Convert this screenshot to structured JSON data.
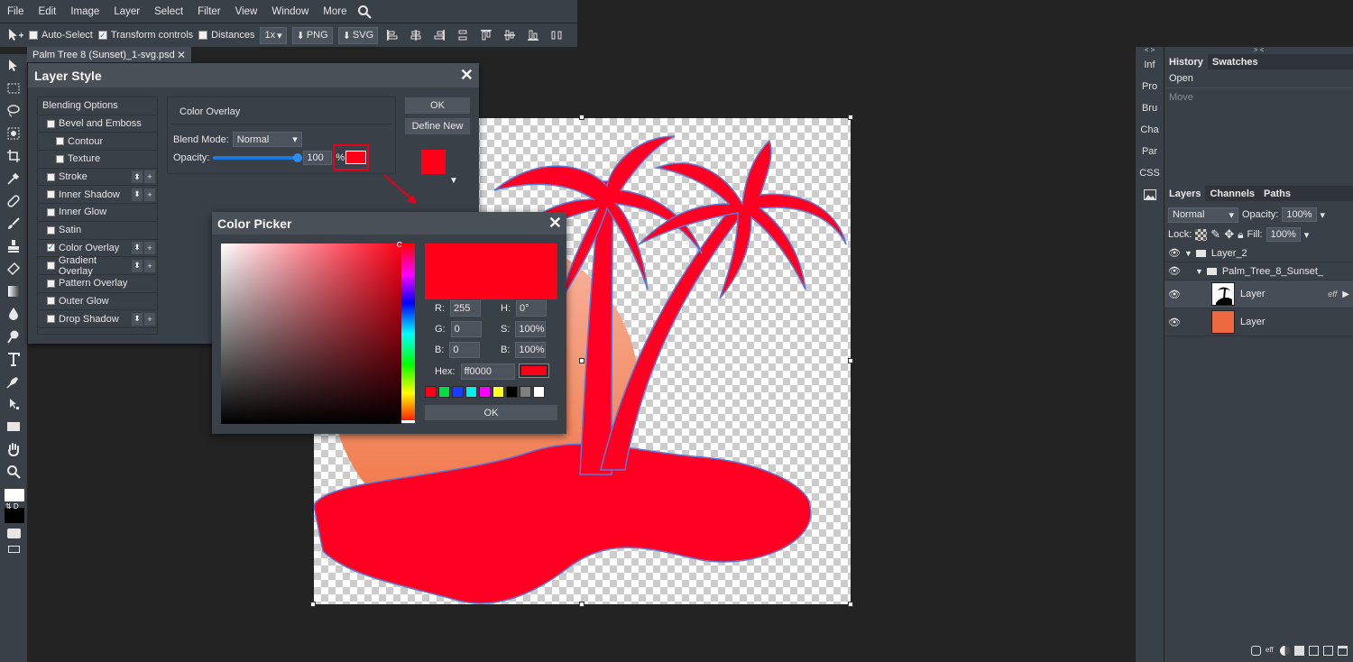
{
  "menu": {
    "items": [
      "File",
      "Edit",
      "Image",
      "Layer",
      "Select",
      "Filter",
      "View",
      "Window",
      "More"
    ]
  },
  "options_bar": {
    "auto_select": {
      "label": "Auto-Select",
      "checked": false
    },
    "transform_controls": {
      "label": "Transform controls",
      "checked": true
    },
    "distances": {
      "label": "Distances",
      "checked": false
    },
    "zoom": "1x",
    "png_label": "PNG",
    "svg_label": "SVG"
  },
  "document_tab": {
    "title": "Palm Tree 8 (Sunset)_1-svg.psd",
    "close": "✕"
  },
  "layer_style": {
    "title": "Layer Style",
    "close": "✕",
    "list": [
      {
        "label": "Blending Options",
        "type": "header"
      },
      {
        "label": "Bevel and Emboss",
        "checked": false,
        "sub": false,
        "controls": false
      },
      {
        "label": "Contour",
        "checked": false,
        "sub": true,
        "controls": false
      },
      {
        "label": "Texture",
        "checked": false,
        "sub": true,
        "controls": false
      },
      {
        "label": "Stroke",
        "checked": false,
        "sub": false,
        "controls": true
      },
      {
        "label": "Inner Shadow",
        "checked": false,
        "sub": false,
        "controls": true
      },
      {
        "label": "Inner Glow",
        "checked": false,
        "sub": false,
        "controls": false
      },
      {
        "label": "Satin",
        "checked": false,
        "sub": false,
        "controls": false
      },
      {
        "label": "Color Overlay",
        "checked": true,
        "sub": false,
        "controls": true
      },
      {
        "label": "Gradient Overlay",
        "checked": false,
        "sub": false,
        "controls": true
      },
      {
        "label": "Pattern Overlay",
        "checked": false,
        "sub": false,
        "controls": false
      },
      {
        "label": "Outer Glow",
        "checked": false,
        "sub": false,
        "controls": false
      },
      {
        "label": "Drop Shadow",
        "checked": false,
        "sub": false,
        "controls": true
      }
    ],
    "section_title": "Color Overlay",
    "blend_mode_label": "Blend Mode:",
    "blend_mode_value": "Normal",
    "opacity_label": "Opacity:",
    "opacity_value": "100",
    "opacity_unit": "%",
    "opacity_level": 1.0,
    "overlay_color": "#ff0018",
    "ok_label": "OK",
    "define_new_label": "Define New"
  },
  "color_picker": {
    "title": "Color Picker",
    "close": "✕",
    "r_label": "R:",
    "r": "255",
    "g_label": "G:",
    "g": "0",
    "b_label": "B:",
    "b": "0",
    "h_label": "H:",
    "h": "0°",
    "s_label": "S:",
    "s": "100%",
    "bv_label": "B:",
    "bv": "100%",
    "hex_label": "Hex:",
    "hex": "ff0000",
    "current_color": "#ff0018",
    "swatches": [
      "#ff0018",
      "#00e040",
      "#1a3cff",
      "#00f0f0",
      "#ff00ff",
      "#ffff20",
      "#000000",
      "#808080",
      "#ffffff"
    ],
    "ok_label": "OK"
  },
  "side_narrow": {
    "items": [
      "Inf",
      "Pro",
      "Bru",
      "Cha",
      "Par",
      "CSS"
    ]
  },
  "history_panel": {
    "tabs": [
      "History",
      "Swatches"
    ],
    "items": [
      {
        "label": "Open",
        "dim": false
      },
      {
        "label": "Move",
        "dim": true
      }
    ]
  },
  "layers_panel": {
    "tabs": [
      "Layers",
      "Channels",
      "Paths"
    ],
    "blend_mode": "Normal",
    "opacity_label": "Opacity:",
    "opacity_value": "100%",
    "lock_label": "Lock:",
    "fill_label": "Fill:",
    "fill_value": "100%",
    "layers": [
      {
        "name": "Layer_2",
        "kind": "group",
        "indent": 0
      },
      {
        "name": "Palm_Tree_8_Sunset_",
        "kind": "group",
        "indent": 1
      },
      {
        "name": "Layer",
        "kind": "layer",
        "indent": 2,
        "badge": "eff"
      },
      {
        "name": "Layer",
        "kind": "layer",
        "indent": 2,
        "badge": ""
      }
    ]
  },
  "colors": {
    "accent_red": "#ff0018",
    "panel_bg": "#3a4048",
    "canvas_bg": "#232323",
    "sunset_orange": "#f07a48"
  }
}
